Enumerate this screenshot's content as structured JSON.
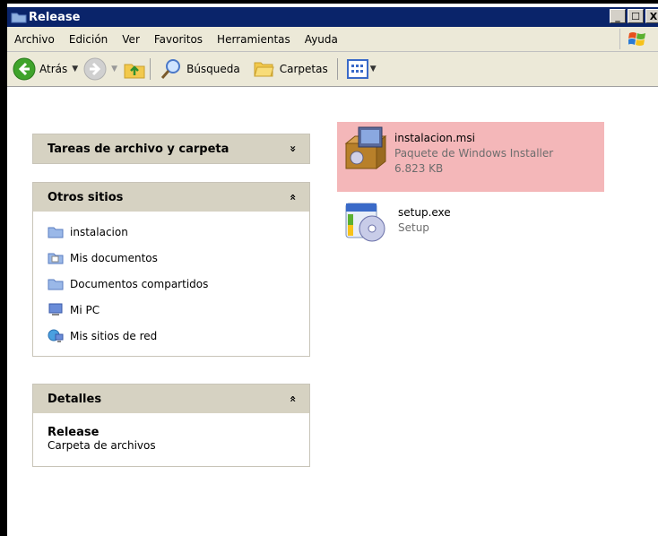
{
  "window": {
    "title": "Release",
    "controls": [
      "_",
      "☐",
      "X"
    ]
  },
  "menu": [
    "Archivo",
    "Edición",
    "Ver",
    "Favoritos",
    "Herramientas",
    "Ayuda"
  ],
  "toolbar": {
    "back": "Atrás",
    "search": "Búsqueda",
    "folders": "Carpetas"
  },
  "panels": {
    "tasks": {
      "title": "Tareas de archivo y carpeta",
      "chevron": "»"
    },
    "places": {
      "title": "Otros sitios",
      "chevron": "«",
      "items": [
        "instalacion",
        "Mis documentos",
        "Documentos compartidos",
        "Mi PC",
        "Mis sitios de red"
      ]
    },
    "details": {
      "title": "Detalles",
      "chevron": "«",
      "name": "Release",
      "type": "Carpeta de archivos"
    }
  },
  "files": [
    {
      "name": "instalacion.msi",
      "type": "Paquete de Windows Installer",
      "size": "6.823 KB",
      "selected": true
    },
    {
      "name": "setup.exe",
      "type": "Setup"
    }
  ],
  "colors": {
    "titlebar": "#0a246a",
    "selection": "#f4b7b9",
    "panel_header": "#d6d2c2",
    "chrome": "#ece9d8"
  }
}
